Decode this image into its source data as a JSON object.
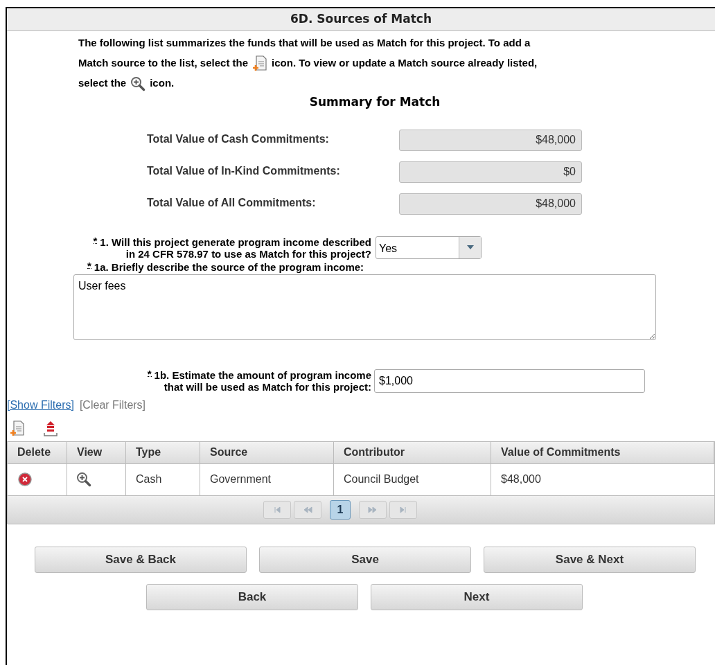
{
  "title": "6D. Sources of Match",
  "intro": [
    [
      "The following list summarizes the funds that will be used as Match for this project. To add a"
    ],
    [
      "Match source to the list, select the",
      "icon. To view or update a Match source already listed,"
    ],
    [
      "select the",
      "icon."
    ]
  ],
  "summary": {
    "heading": "Summary for Match",
    "rows": [
      {
        "label": "Total Value of Cash Commitments:",
        "value": "$48,000"
      },
      {
        "label": "Total Value of In-Kind Commitments:",
        "value": "$0"
      },
      {
        "label": "Total Value of All Commitments:",
        "value": "$48,000"
      }
    ]
  },
  "q1": {
    "marker": "*",
    "label": [
      "1. Will this project generate program income described",
      "in 24 CFR 578.97 to use as Match for this project?"
    ],
    "value": "Yes"
  },
  "q1a": {
    "marker": "*",
    "label": [
      "1a. Briefly describe the source of the program income:"
    ],
    "value": "User fees"
  },
  "q1b": {
    "marker": "*",
    "label": [
      "1b. Estimate the amount of program income",
      "that will be used as Match for this project:"
    ],
    "value": "$1,000"
  },
  "filters": {
    "show": "[Show Filters]",
    "clear": "[Clear Filters]"
  },
  "table": {
    "columns": [
      "Delete",
      "View",
      "Type",
      "Source",
      "Contributor",
      "Value of Commitments"
    ],
    "rows": [
      {
        "type": "Cash",
        "source": "Government",
        "contributor": "Council Budget",
        "value": "$48,000"
      }
    ]
  },
  "pager": {
    "pages": [
      {
        "label": "1",
        "selected": true
      }
    ]
  },
  "buttons": [
    [
      "Save & Back",
      "Save",
      "Save & Next"
    ],
    [
      "Back",
      "Next"
    ]
  ]
}
